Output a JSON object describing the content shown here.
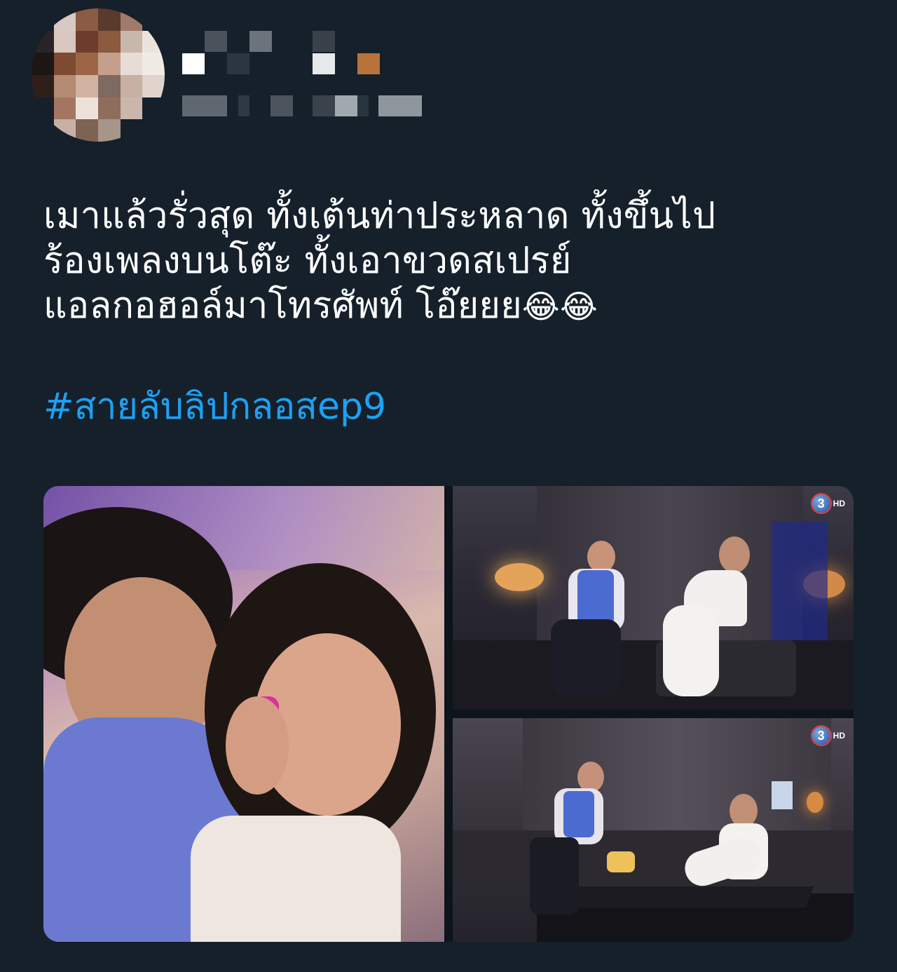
{
  "tweet": {
    "text": "เมาแล้วรั่วสุด ทั้งเต้นท่าประหลาด ทั้งขึ้นไป\nร้องเพลงบนโต๊ะ ทั้งเอาขวดสเปรย์\nแอลกอฮอล์มาโทรศัพท์ โอ๊ยยย",
    "emoji": "😂😂",
    "hashtag": "#สายลับลิปกลอสep9"
  },
  "media": {
    "channel_logo_digit": "3",
    "channel_logo_suffix": "HD"
  },
  "colors": {
    "background": "#15202b",
    "hashtag": "#1da1f2"
  }
}
